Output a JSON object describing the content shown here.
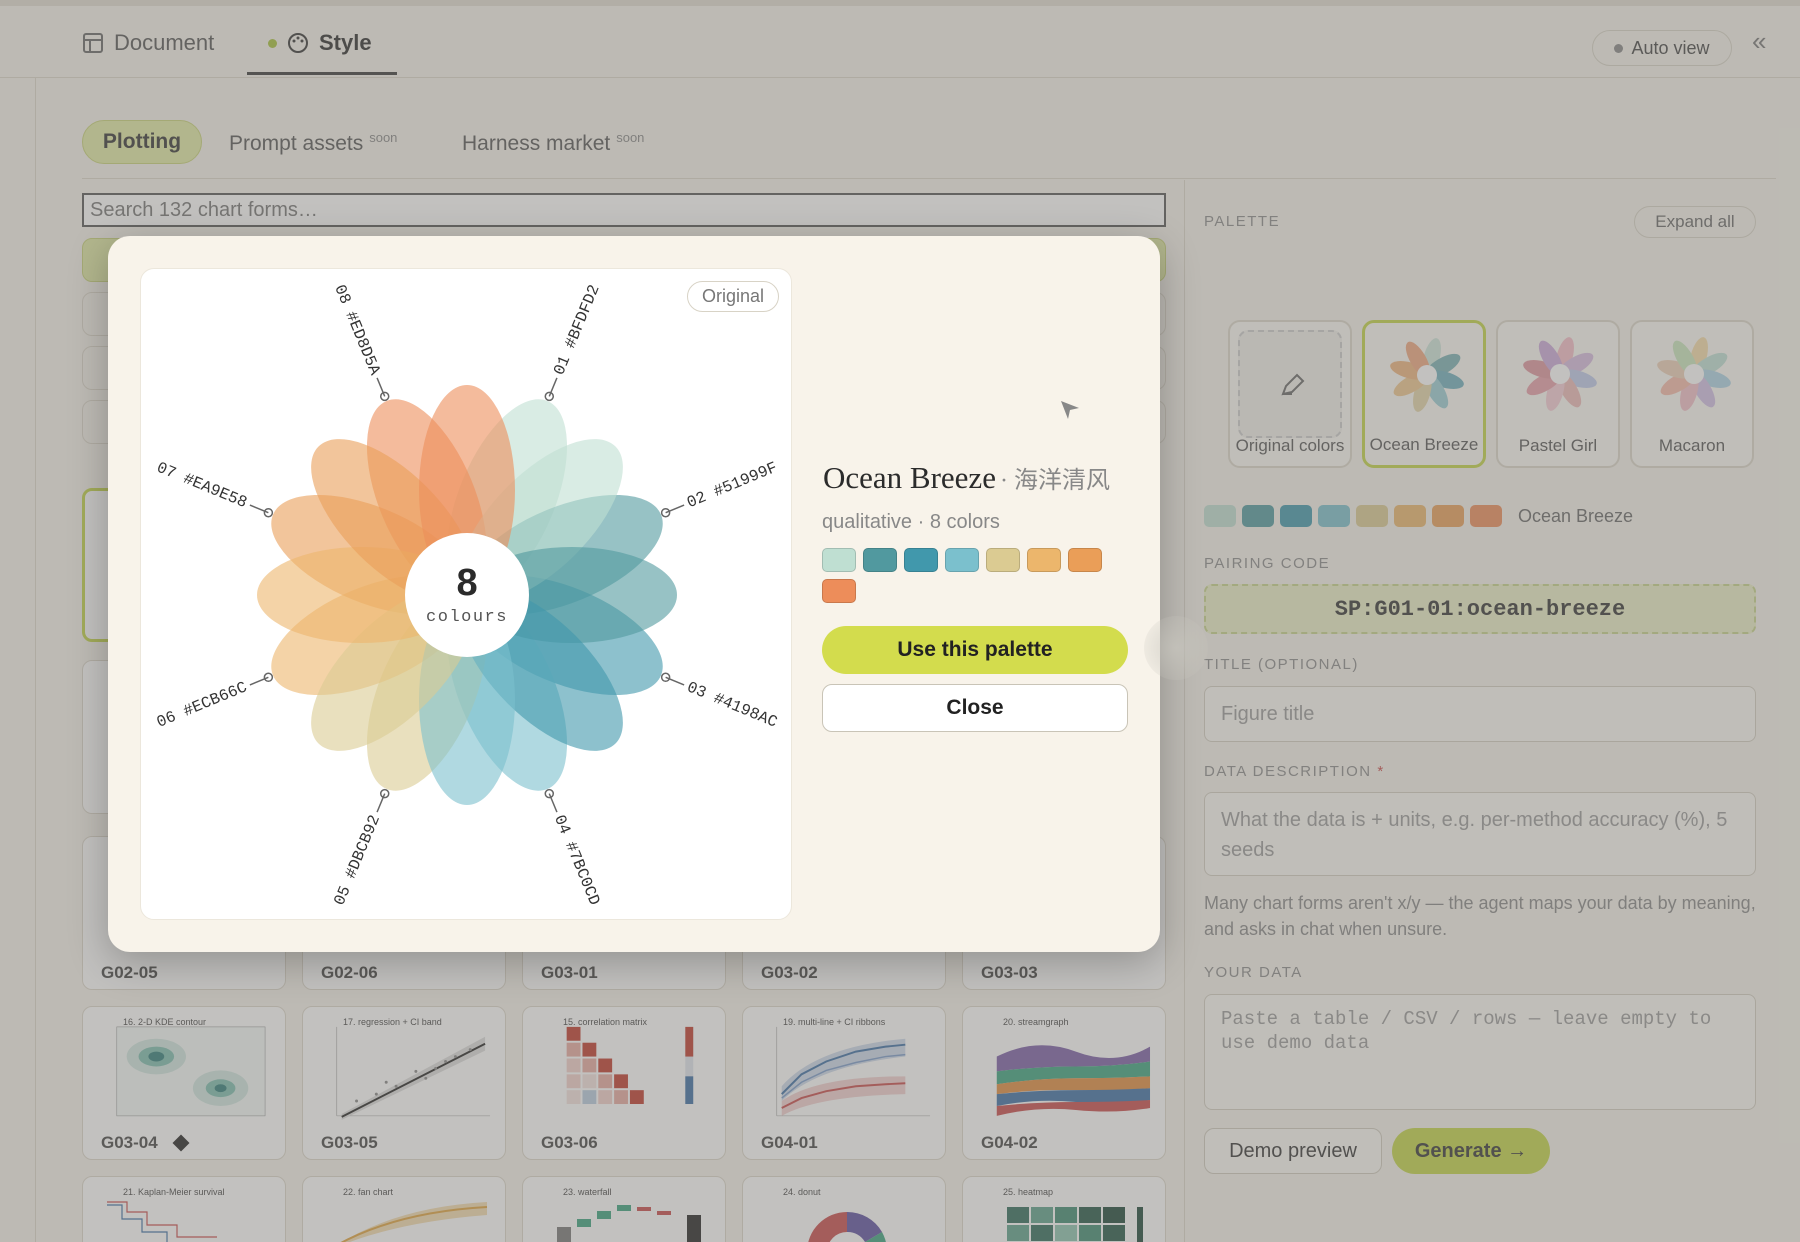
{
  "tabs": [
    {
      "label": "Document"
    },
    {
      "label": "Style"
    }
  ],
  "auto_view_label": "Auto view",
  "subtabs": {
    "plotting": "Plotting",
    "prompt_assets": "Prompt assets",
    "harness_market": "Harness market",
    "soon": "soon"
  },
  "search": {
    "placeholder": "Search 132 chart forms…"
  },
  "chart_cards": [
    {
      "code": "G02-05"
    },
    {
      "code": "G02-06"
    },
    {
      "code": "G03-01"
    },
    {
      "code": "G03-02"
    },
    {
      "code": "G03-03"
    },
    {
      "code": "G03-04",
      "title": "16. 2-D KDE contour"
    },
    {
      "code": "G03-05",
      "title": "17. regression + CI band"
    },
    {
      "code": "G03-06",
      "title": "15. correlation matrix"
    },
    {
      "code": "G04-01",
      "title": "19. multi-line + CI ribbons"
    },
    {
      "code": "G04-02",
      "title": "20. streamgraph"
    },
    {
      "title": "21. Kaplan-Meier survival"
    },
    {
      "title": "22. fan chart"
    },
    {
      "title": "23. waterfall"
    },
    {
      "title": "24. donut"
    },
    {
      "title": "25. heatmap"
    }
  ],
  "palette_panel": {
    "label": "PALETTE",
    "expand_all": "Expand all",
    "cards": [
      {
        "name": "Original colors"
      },
      {
        "name": "Ocean Breeze"
      },
      {
        "name": "Pastel Girl"
      },
      {
        "name": "Macaron"
      }
    ],
    "strip_name": "Ocean Breeze",
    "pairing_label": "PAIRING CODE",
    "pairing_code": "SP:G01-01:ocean-breeze",
    "title_label": "TITLE (OPTIONAL)",
    "title_placeholder": "Figure title",
    "data_desc_label": "DATA DESCRIPTION",
    "data_desc_required": "*",
    "data_desc_placeholder": "What the data is + units, e.g. per-method accuracy (%), 5 seeds",
    "hint": "Many chart forms aren't x/y — the agent maps your data by meaning, and asks in chat when unsure.",
    "your_data_label": "YOUR DATA",
    "your_data_placeholder": "Paste a table / CSV / rows — leave empty to use demo data",
    "demo_preview": "Demo preview",
    "generate": "Generate →"
  },
  "modal": {
    "badge": "Original",
    "center_count": "8",
    "center_unit": "colours",
    "name": "Ocean Breeze",
    "name_cn": "· 海洋清风",
    "meta": "qualitative · 8 colors",
    "use_button": "Use this palette",
    "close_button": "Close",
    "colors": [
      {
        "label": "01 #BFDFD2",
        "hex": "#BFDFD2"
      },
      {
        "label": "02 #51999F",
        "hex": "#51999F"
      },
      {
        "label": "03 #4198AC",
        "hex": "#4198AC"
      },
      {
        "label": "04 #7BC0CD",
        "hex": "#7BC0CD"
      },
      {
        "label": "05 #DBCB92",
        "hex": "#DBCB92"
      },
      {
        "label": "06 #ECB66C",
        "hex": "#ECB66C"
      },
      {
        "label": "07 #EA9E58",
        "hex": "#EA9E58"
      },
      {
        "label": "08 #ED8D5A",
        "hex": "#ED8D5A"
      }
    ]
  }
}
